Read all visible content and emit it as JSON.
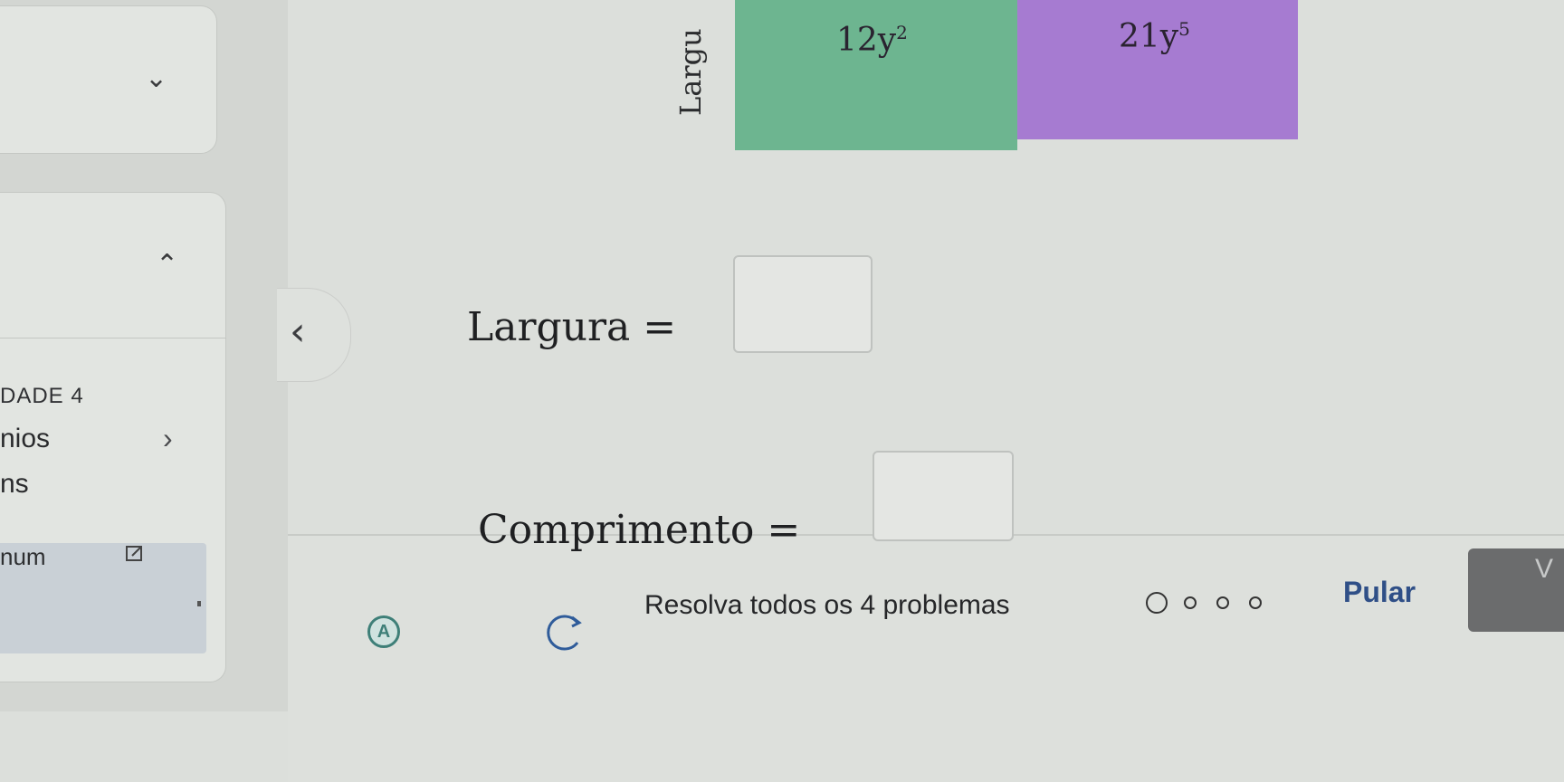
{
  "sidebar": {
    "top_card_chevron": "chevron-down",
    "mid_card_chevron": "chevron-up",
    "unit_label": "DADE 4",
    "item_1": "nios",
    "item_2": "ns",
    "selected_item": "num"
  },
  "problem": {
    "rotated_label": "Largu",
    "green_term": "12y",
    "green_exp": "2",
    "purple_term": "21y",
    "purple_exp": "5",
    "colors": {
      "green": "#6db590",
      "purple": "#a67bd1"
    }
  },
  "answers": {
    "largura_label": "Largura =",
    "comprimento_label": "Comprimento ="
  },
  "footer": {
    "progress_text": "Resolva todos os 4 problemas",
    "skip_label": "Pular",
    "next_label": "V",
    "total_problems": 4,
    "current_problem": 1
  }
}
